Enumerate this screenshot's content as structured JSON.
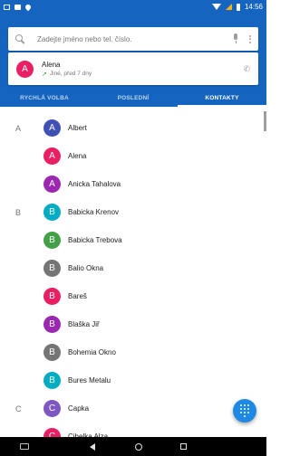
{
  "status_bar": {
    "time": "14:56",
    "colors": {
      "background": "#1565c0",
      "signal": "#ffb300"
    }
  },
  "search": {
    "placeholder": "Zadejte jméno nebo tel. číslo.",
    "value": ""
  },
  "recent_call": {
    "avatar_letter": "A",
    "name": "Alena",
    "detail": "Jiné, před 7 dny",
    "avatar_color": "#e91e63"
  },
  "tabs": [
    {
      "label": "RYCHLÁ VOLBA",
      "active": false
    },
    {
      "label": "POSLEDNÍ",
      "active": false
    },
    {
      "label": "KONTAKTY",
      "active": true
    }
  ],
  "contacts": [
    {
      "section": "A",
      "initial": "A",
      "name": "Albert",
      "color": "#3f51b5"
    },
    {
      "section": "",
      "initial": "A",
      "name": "Alena",
      "color": "#e91e63"
    },
    {
      "section": "",
      "initial": "A",
      "name": "Anicka Tahalova",
      "color": "#9c27b0"
    },
    {
      "section": "B",
      "initial": "B",
      "name": "Babicka Krenov",
      "color": "#00acc1"
    },
    {
      "section": "",
      "initial": "B",
      "name": "Babicka Trebova",
      "color": "#43a047"
    },
    {
      "section": "",
      "initial": "B",
      "name": "Balio Okna",
      "color": "#757575"
    },
    {
      "section": "",
      "initial": "B",
      "name": "Bareš",
      "color": "#e91e63"
    },
    {
      "section": "",
      "initial": "B",
      "name": "Blaška Jiř",
      "color": "#9c27b0"
    },
    {
      "section": "",
      "initial": "B",
      "name": "Bohemia Okno",
      "color": "#757575"
    },
    {
      "section": "",
      "initial": "B",
      "name": "Bures Metalu",
      "color": "#00acc1"
    },
    {
      "section": "C",
      "initial": "C",
      "name": "Capka",
      "color": "#7e57c2"
    },
    {
      "section": "",
      "initial": "C",
      "name": "Cibelka Alza",
      "color": "#e91e63"
    }
  ],
  "icons": {
    "search": "search-icon",
    "mic": "mic-icon",
    "more": "more-vert-icon",
    "call_direction": "outgoing-call-icon",
    "phone": "phone-icon",
    "fab": "dialpad-icon",
    "nav": [
      "screenshot-icon",
      "back-icon",
      "home-icon",
      "recent-apps-icon"
    ]
  },
  "colors": {
    "primary": "#1565c0",
    "fab": "#1e88e5"
  }
}
